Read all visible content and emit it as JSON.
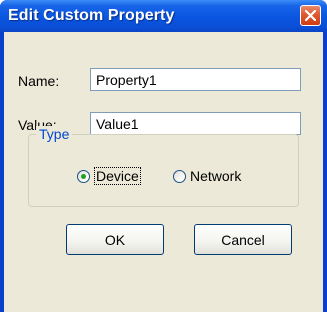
{
  "dialog": {
    "title": "Edit Custom Property",
    "close_icon": "close-icon",
    "name_label": "Name:",
    "name_value": "Property1",
    "value_label": "Value:",
    "value_value": "Value1",
    "type_group_label": "Type",
    "radio_device_label": "Device",
    "radio_network_label": "Network",
    "selected_type": "Device",
    "ok_label": "OK",
    "cancel_label": "Cancel"
  },
  "colors": {
    "titlebar": "#0a55df",
    "window_frame": "#0a3fc9",
    "client_bg": "#ece9d8",
    "close_button": "#e0582e",
    "group_label": "#0046d5",
    "radio_dot": "#21a121"
  }
}
